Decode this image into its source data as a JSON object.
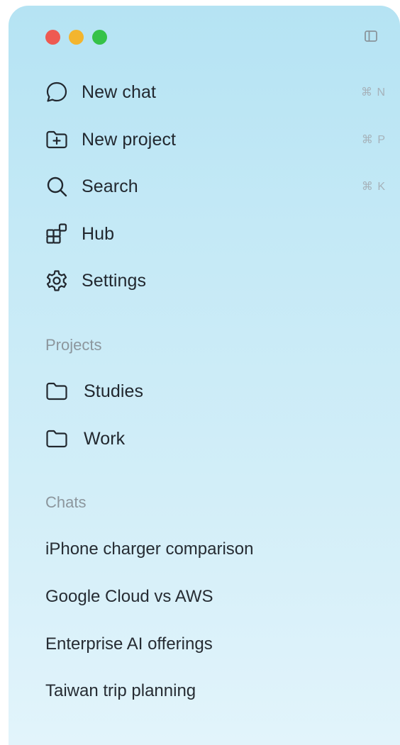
{
  "nav": [
    {
      "label": "New chat",
      "shortcut": "⌘ N",
      "icon": "chat-bubble-icon"
    },
    {
      "label": "New project",
      "shortcut": "⌘ P",
      "icon": "folder-plus-icon"
    },
    {
      "label": "Search",
      "shortcut": "⌘ K",
      "icon": "search-icon"
    },
    {
      "label": "Hub",
      "shortcut": "",
      "icon": "hub-grid-icon"
    },
    {
      "label": "Settings",
      "shortcut": "",
      "icon": "gear-icon"
    }
  ],
  "projects": {
    "title": "Projects",
    "items": [
      {
        "label": "Studies",
        "icon": "folder-icon"
      },
      {
        "label": "Work",
        "icon": "folder-icon"
      }
    ]
  },
  "chats": {
    "title": "Chats",
    "items": [
      "iPhone charger comparison",
      "Google Cloud vs AWS",
      "Enterprise AI offerings",
      "Taiwan trip planning"
    ]
  },
  "colors": {
    "window_close": "#ee5a52",
    "window_minimize": "#f3b52e",
    "window_zoom": "#36c248",
    "background_top": "#b5e3f3",
    "background_bottom": "#e2f4fb"
  }
}
